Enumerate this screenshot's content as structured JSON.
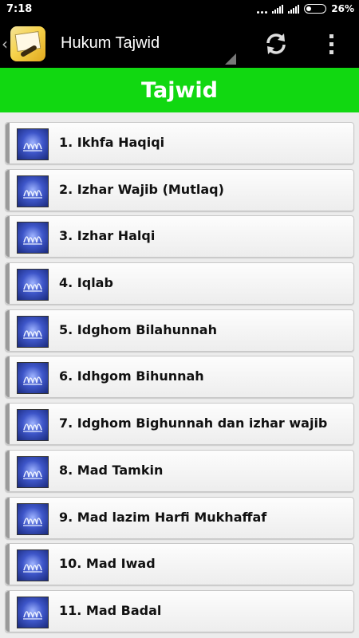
{
  "status_bar": {
    "time": "7:18",
    "battery": "26%",
    "battery_level": 0.26
  },
  "action_bar": {
    "title": "Hukum Tajwid",
    "app_icon": "quran-book-icon",
    "actions": [
      "refresh-icon",
      "overflow-menu-icon"
    ]
  },
  "header": {
    "title": "Tajwid",
    "color": "#11d811"
  },
  "list": {
    "item_icon": "allah-calligraphy-icon",
    "items": [
      {
        "label": "1. Ikhfa Haqiqi"
      },
      {
        "label": "2. Izhar Wajib (Mutlaq)"
      },
      {
        "label": "3. Izhar Halqi"
      },
      {
        "label": "4. Iqlab"
      },
      {
        "label": "5. Idghom Bilahunnah"
      },
      {
        "label": "6. Idhgom Bihunnah"
      },
      {
        "label": "7. Idghom Bighunnah dan izhar wajib"
      },
      {
        "label": "8. Mad Tamkin"
      },
      {
        "label": "9. Mad lazim Harfi Mukhaffaf"
      },
      {
        "label": "10. Mad Iwad"
      },
      {
        "label": "11. Mad Badal"
      }
    ]
  }
}
